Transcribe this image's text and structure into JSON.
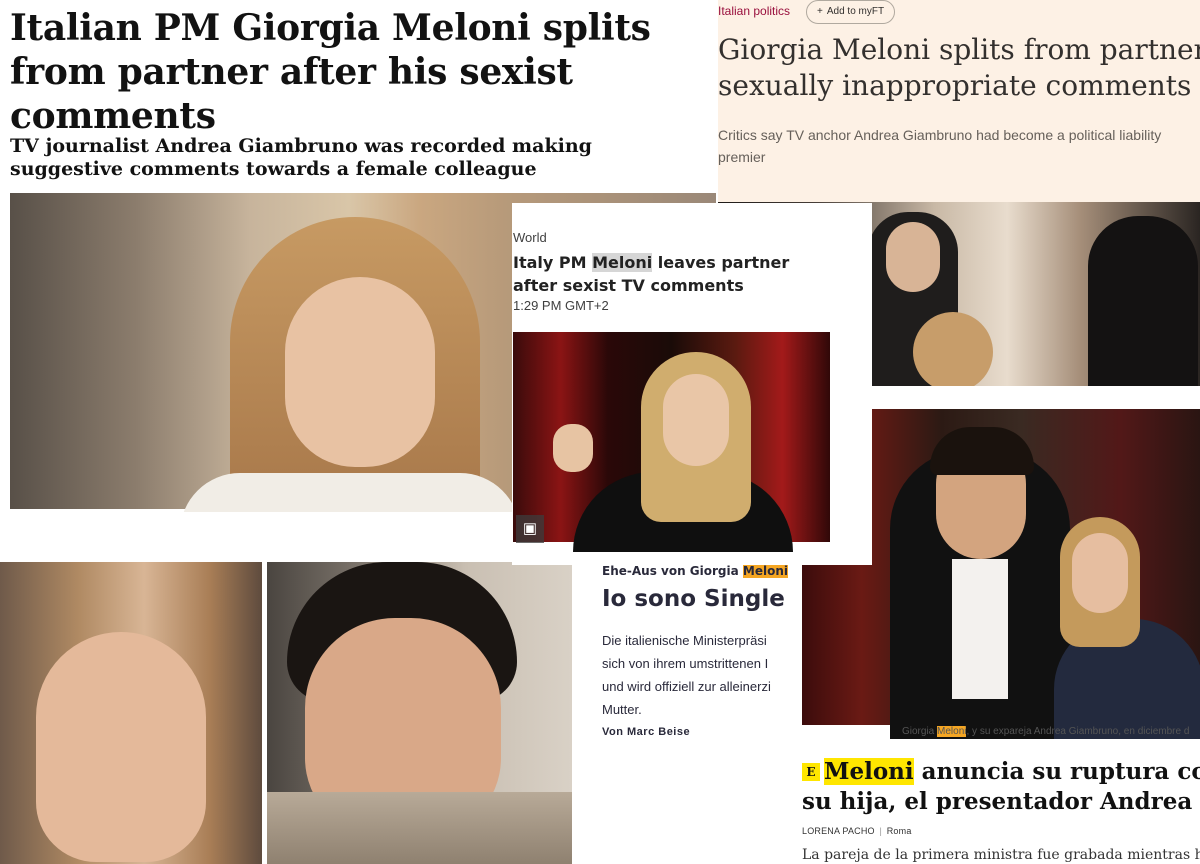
{
  "guardian": {
    "headline": "Italian PM Giorgia Meloni splits from partner after his sexist comments",
    "standfirst": "TV journalist Andrea Giambruno was recorded making suggestive comments towards a female colleague"
  },
  "ft": {
    "section": "Italian politics",
    "add_button": "Add to myFT",
    "headline_line1": "Giorgia Meloni splits from partner aft",
    "headline_line2": "sexually inappropriate comments",
    "standfirst_line1": "Critics say TV anchor Andrea Giambruno had become a political liability",
    "standfirst_line2": "premier"
  },
  "reuters": {
    "section": "World",
    "headline_pre": "Italy PM ",
    "headline_highlight": "Meloni",
    "headline_post": " leaves partner after sexist TV comments",
    "timestamp": "1:29 PM GMT+2"
  },
  "sz": {
    "kicker_pre": "Ehe-Aus von Giorgia ",
    "kicker_highlight": "Meloni",
    "headline": "Io sono Single",
    "teaser_line1": "Die italienische Ministerpräsi",
    "teaser_line2": "sich von ihrem umstrittenen I",
    "teaser_line3": "und wird offiziell zur alleinerzi",
    "teaser_line4": "Mutter.",
    "author": "Von Marc Beise"
  },
  "elpais": {
    "caption_pre": "Giorgia ",
    "caption_highlight": "Meloni",
    "caption_post": ", y su expareja Andrea Giambruno, en diciembre d",
    "logo_letter": "E",
    "headline_highlight": "Meloni",
    "headline_line1_post": " anuncia su ruptura con",
    "headline_line2": "su hija, el presentador Andrea G",
    "byline_author": "LORENA PACHO",
    "byline_sep": "|",
    "byline_place": "Roma",
    "body": "La pareja de la primera ministra fue grabada mientras hac"
  },
  "colors": {
    "ft_background": "#fdf1e5",
    "ft_section": "#990f3d",
    "highlight_orange": "#f5a623",
    "highlight_yellow": "#ffe600",
    "highlight_gray": "#d6d6d6"
  }
}
